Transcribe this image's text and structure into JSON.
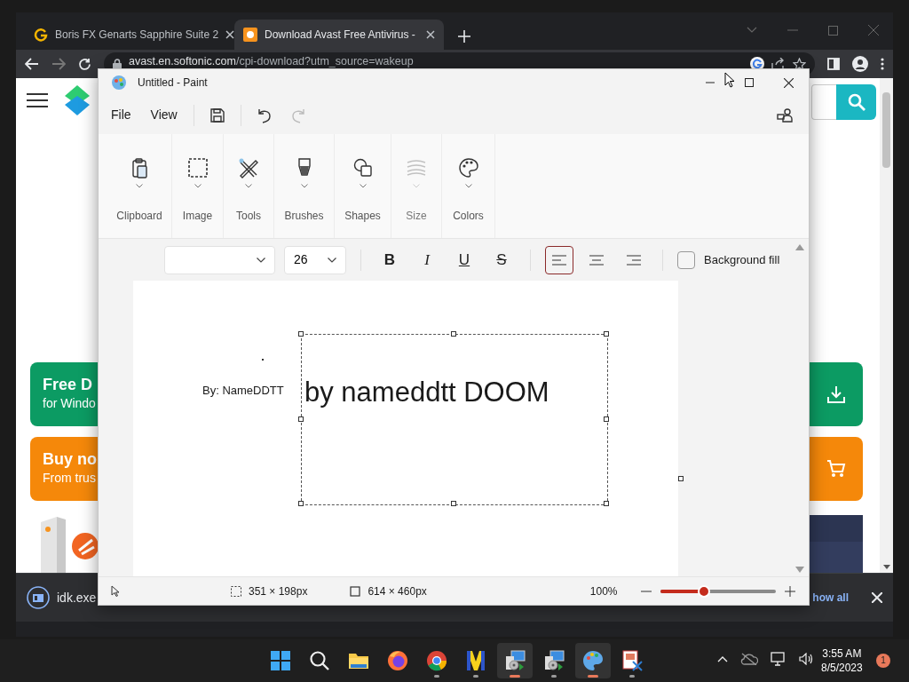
{
  "browser": {
    "tabs": [
      {
        "title": "Boris FX Genarts Sapphire Suite 2",
        "selected": false
      },
      {
        "title": "Download Avast Free Antivirus -",
        "selected": true
      }
    ],
    "address": {
      "host": "avast.en.softonic.com",
      "path": "/cpi-download?utm_source=wakeup"
    }
  },
  "web_page": {
    "cards": [
      {
        "kind": "download",
        "title": "Free D",
        "subtitle": "for Windo",
        "color": "#0c9b63"
      },
      {
        "kind": "buy",
        "title": "Buy no",
        "subtitle": "From trus",
        "color": "#f5880a"
      }
    ]
  },
  "downloads": {
    "file": "idk.exe",
    "show_all": "how all"
  },
  "paint": {
    "title": "Untitled - Paint",
    "menu": [
      "File",
      "View"
    ],
    "ribbon": [
      {
        "kind": "clipboard",
        "label": "Clipboard",
        "disabled": false
      },
      {
        "label": "Image",
        "disabled": false
      },
      {
        "kind": "tools",
        "label": "Tools",
        "disabled": false
      },
      {
        "kind": "brushes",
        "label": "Brushes",
        "disabled": false
      },
      {
        "kind": "shapes",
        "label": "Shapes",
        "disabled": false
      },
      {
        "kind": "size",
        "label": "Size",
        "disabled": true
      },
      {
        "kind": "colors",
        "label": "Colors",
        "disabled": false
      }
    ],
    "text_toolbar": {
      "size": "26",
      "styles": [
        {
          "kind": "bold",
          "label": "B",
          "selected": false
        },
        {
          "kind": "italic",
          "label": "I",
          "selected": false
        },
        {
          "kind": "underline",
          "label": "U",
          "selected": false
        },
        {
          "kind": "strike",
          "label": "S",
          "selected": false
        }
      ],
      "alignments": [
        {
          "kind": "left",
          "selected": true
        },
        {
          "kind": "center",
          "selected": false
        },
        {
          "kind": "right",
          "selected": false
        }
      ],
      "background_fill": {
        "label": "Background fill",
        "checked": false
      }
    },
    "canvas": {
      "texts": [
        "By: NameDDTT"
      ],
      "text_box": {
        "text": "by nameddtt DOOM"
      }
    },
    "status_bar": {
      "selection_size": "351 × 198px",
      "canvas_size": "614 × 460px",
      "zoom": "100%",
      "zoom_slider": {
        "level": 0.38
      }
    }
  },
  "taskbar": {
    "apps": [
      {
        "kind": "start",
        "running": false,
        "active": false
      },
      {
        "kind": "search",
        "running": false,
        "active": false
      },
      {
        "kind": "files",
        "running": false,
        "active": false
      },
      {
        "kind": "firefox",
        "running": false,
        "active": false
      },
      {
        "kind": "chrome",
        "running": true,
        "active": false
      },
      {
        "kind": "m-app",
        "running": true,
        "active": false
      },
      {
        "kind": "installer",
        "running": true,
        "active": true
      },
      {
        "kind": "installer",
        "running": true,
        "active": false
      },
      {
        "kind": "paint",
        "running": true,
        "active": true
      },
      {
        "kind": "snip",
        "running": true,
        "active": false
      }
    ],
    "time": "3:55 AM",
    "date": "8/5/2023",
    "notifications": "1"
  }
}
